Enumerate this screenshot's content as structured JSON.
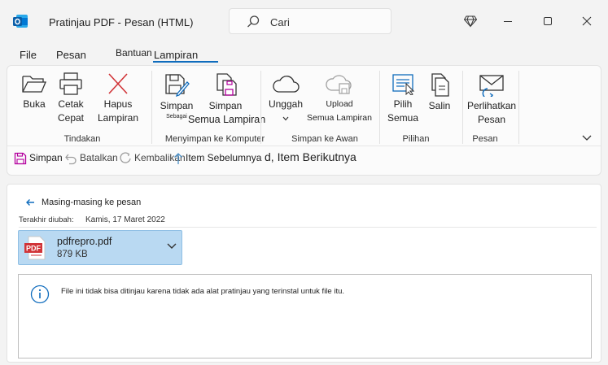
{
  "window": {
    "title_part1": "Pratinjau PDF -",
    "title_part2": "Pesan (HTML)",
    "search_placeholder": "Cari"
  },
  "menu": {
    "file": "File",
    "message": "Pesan",
    "help": "Bantuan",
    "attachments": "Lampiran"
  },
  "ribbon": {
    "open": "Buka",
    "quick_print_1": "Cetak",
    "quick_print_2": "Cepat",
    "remove_1": "Hapus",
    "remove_2": "Lampiran",
    "group_actions": "Tindakan",
    "save_as_1": "Simpan",
    "save_as_2": "Sebagai",
    "save_all_1": "Simpan",
    "save_all_2": "Semua Lampiran",
    "group_save_computer": "Menyimpan ke Komputer",
    "upload": "Unggah",
    "upload_all_1": "Upload",
    "upload_all_2": "Semua Lampiran",
    "group_save_cloud": "Simpan ke Awan",
    "select_all_1": "Pilih",
    "select_all_2": "Semua",
    "copy": "Salin",
    "group_selection": "Pilihan",
    "show_message_1": "Perlihatkan",
    "show_message_2": "Pesan",
    "group_message": "Pesan"
  },
  "qat": {
    "save": "Simpan",
    "undo": "Batalkan",
    "redo": "Kembalikan",
    "previous": "Item Sebelumnya",
    "next": "d, Item Berikutnya"
  },
  "reading": {
    "back": "Masing-masing ke pesan",
    "modified_label": "Terakhir diubah:",
    "modified_value": "Kamis, 17 Maret 2022",
    "attachment_name": "pdfrepro.pdf",
    "attachment_size": "879 KB",
    "pdf_badge": "PDF",
    "notice": "File ini tidak bisa ditinjau karena tidak ada alat pratinjau yang terinstal untuk file itu."
  },
  "colors": {
    "accent": "#0f6cbd",
    "attachment_bg": "#b9d9f2",
    "pdf_red": "#d13438"
  }
}
